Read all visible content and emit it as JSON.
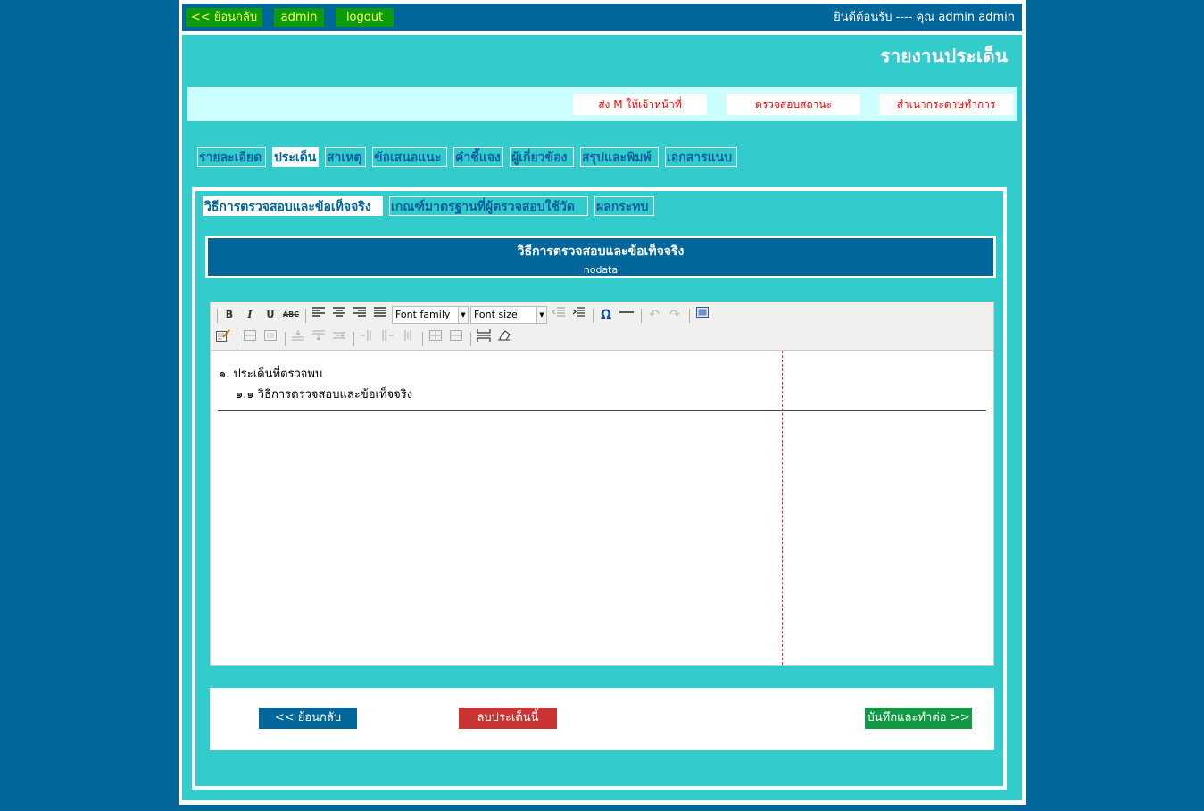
{
  "topbar": {
    "back_label": "<< ย้อนกลับ",
    "user_label": "admin",
    "logout_label": "logout",
    "welcome_text": "ยินดีต้อนรับ ---- คุณ admin admin"
  },
  "page": {
    "title": "รายงานประเด็น"
  },
  "actions": {
    "send_m": "ส่ง M ให้เจ้าหน้าที่",
    "check_status": "ตรวจสอบสถานะ",
    "copy_working_paper": "สำเนากระดาษทำการ"
  },
  "main_tabs": [
    {
      "label": "รายละเอียด",
      "active": false
    },
    {
      "label": "ประเด็น",
      "active": true
    },
    {
      "label": "สาเหตุ",
      "active": false
    },
    {
      "label": "ข้อเสนอแนะ",
      "active": false
    },
    {
      "label": "คำชี้แจง",
      "active": false
    },
    {
      "label": "ผู้เกี่ยวข้อง",
      "active": false
    },
    {
      "label": "สรุปและพิมพ์",
      "active": false
    },
    {
      "label": "เอกสารแนบ",
      "active": false
    }
  ],
  "sub_tabs": [
    {
      "label": "วิธีการตรวจสอบและข้อเท็จจริง",
      "active": true
    },
    {
      "label": "เกณฑ์มาตรฐานที่ผู้ตรวจสอบใช้วัด",
      "active": false
    },
    {
      "label": "ผลกระทบ",
      "active": false
    }
  ],
  "section": {
    "title": "วิธีการตรวจสอบและข้อเท็จจริง",
    "subtitle": "nodata"
  },
  "editor": {
    "font_family": "Font family",
    "font_size": "Font size",
    "content_line1": "๑. ประเด็นที่ตรวจพบ",
    "content_line2": "๑.๑ วิธีการตรวจสอบและข้อเท็จจริง"
  },
  "bottom": {
    "back_label": "<< ย้อนกลับ",
    "delete_label": "ลบประเด็นนี้",
    "save_next_label": "บันทึกและทำต่อ >>"
  },
  "colors": {
    "background": "#01669a",
    "panel": "#33cccc",
    "action_bar": "#ccffff",
    "green_button": "#0b9b0b",
    "delete_button": "#cc3333",
    "save_button": "#119944"
  }
}
